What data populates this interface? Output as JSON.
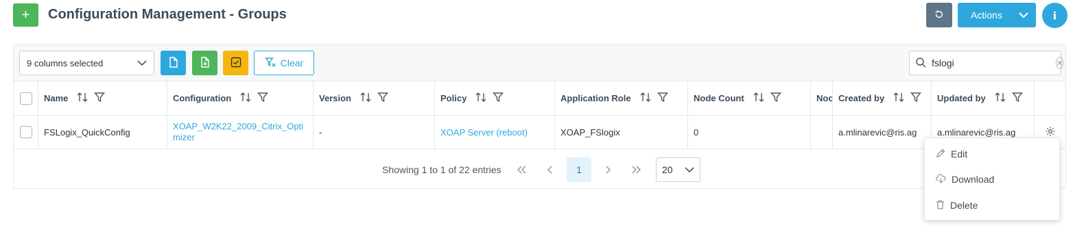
{
  "header": {
    "add_label": "+",
    "title": "Configuration Management - Groups",
    "actions_label": "Actions",
    "info_label": "i"
  },
  "toolbar": {
    "columns_selected": "9 columns selected",
    "clear_label": "Clear",
    "search_value": "fslogi"
  },
  "table": {
    "columns": [
      {
        "label": "Name"
      },
      {
        "label": "Configuration"
      },
      {
        "label": "Version"
      },
      {
        "label": "Policy"
      },
      {
        "label": "Application Role"
      },
      {
        "label": "Node Count"
      },
      {
        "label": "Noc"
      },
      {
        "label": "Created by"
      },
      {
        "label": "Updated by"
      }
    ],
    "rows": [
      {
        "name": "FSLogix_QuickConfig",
        "configuration": "XOAP_W2K22_2009_Citrix_Optimizer",
        "version": "-",
        "policy": "XOAP Server (reboot)",
        "application_role": "XOAP_FSlogix",
        "node_count": "0",
        "noc": "",
        "created_by": "a.mlinarevic@ris.ag",
        "updated_by": "a.mlinarevic@ris.ag"
      }
    ]
  },
  "pagination": {
    "info": "Showing 1 to 1 of 22 entries",
    "current_page": "1",
    "page_size": "20"
  },
  "context_menu": {
    "items": [
      {
        "label": "Edit",
        "icon": "pencil-icon"
      },
      {
        "label": "Download",
        "icon": "cloud-download-icon"
      },
      {
        "label": "Delete",
        "icon": "trash-icon"
      }
    ]
  },
  "colors": {
    "primary": "#2ea8dc",
    "success": "#4db55a",
    "warning": "#f5b70e",
    "slate": "#5d7586",
    "title": "#3d4b57"
  }
}
